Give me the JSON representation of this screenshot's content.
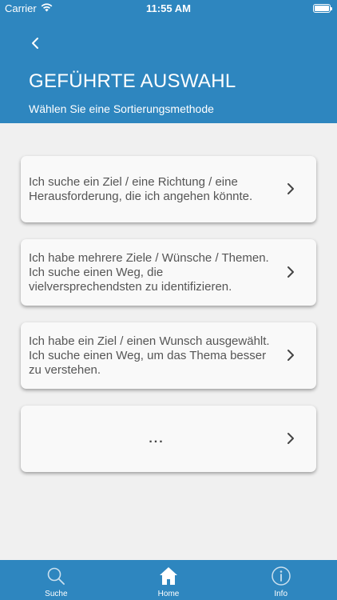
{
  "status_bar": {
    "carrier": "Carrier",
    "time": "11:55 AM"
  },
  "header": {
    "title": "GEFÜHRTE AUSWAHL",
    "subtitle": "Wählen Sie eine Sortierungsmethode"
  },
  "cards": [
    {
      "text": "Ich suche ein Ziel / eine Richtung / eine Herausforderung, die ich angehen könnte."
    },
    {
      "text": "Ich habe mehrere Ziele / Wünsche / Themen. Ich suche einen Weg, die vielversprechendsten zu identifizieren."
    },
    {
      "text": "Ich habe ein Ziel / einen Wunsch ausgewählt. Ich suche einen Weg, um das Thema besser zu verstehen."
    },
    {
      "text": "..."
    }
  ],
  "tabs": [
    {
      "label": "Suche",
      "icon": "search-icon"
    },
    {
      "label": "Home",
      "icon": "home-icon"
    },
    {
      "label": "Info",
      "icon": "info-icon"
    }
  ],
  "colors": {
    "header_blue": "#2e86bf",
    "background": "#f0f0f0",
    "card": "#f9f9f9"
  }
}
